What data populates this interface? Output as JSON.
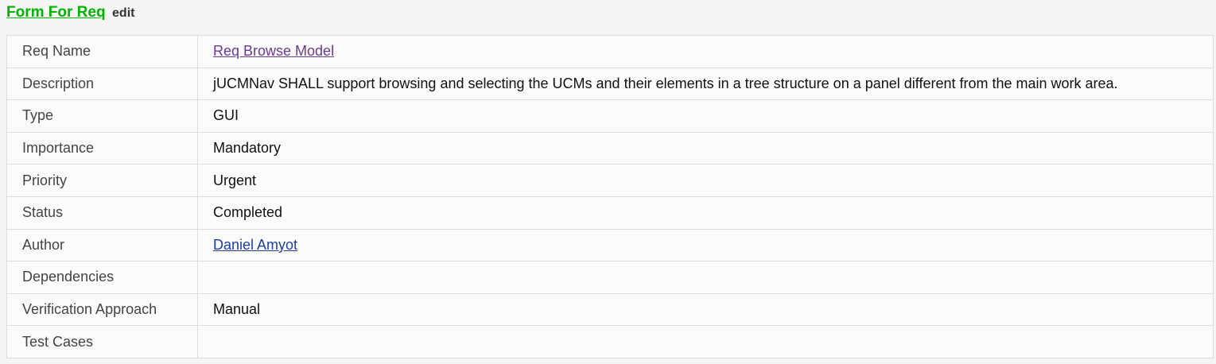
{
  "header": {
    "title": "Form For Req",
    "edit_label": "edit",
    "title_color": "#00b400"
  },
  "fields": [
    {
      "label": "Req Name",
      "value": "Req Browse Model",
      "link": true
    },
    {
      "label": "Description",
      "value": "jUCMNav SHALL support browsing and selecting the UCMs and their elements in a tree structure on a panel different from the main work area."
    },
    {
      "label": "Type",
      "value": "GUI"
    },
    {
      "label": "Importance",
      "value": "Mandatory"
    },
    {
      "label": "Priority",
      "value": "Urgent"
    },
    {
      "label": "Status",
      "value": "Completed"
    },
    {
      "label": "Author",
      "value": "Daniel Amyot",
      "link": true
    },
    {
      "label": "Dependencies",
      "value": ""
    },
    {
      "label": "Verification Approach",
      "value": "Manual"
    },
    {
      "label": "Test Cases",
      "value": ""
    }
  ],
  "colors": {
    "visited_link": "#6a3a8e",
    "link": "#1e3f9a"
  }
}
